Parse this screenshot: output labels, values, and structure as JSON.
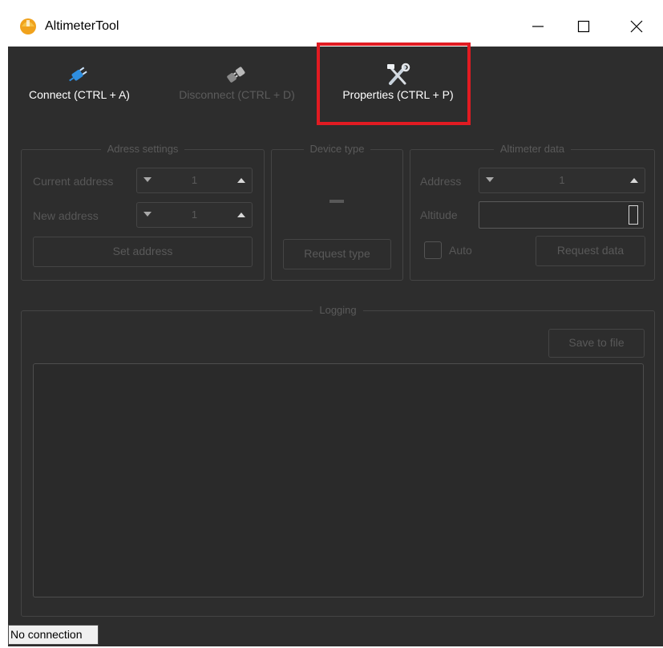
{
  "window": {
    "title": "AltimeterTool",
    "controls": {
      "minimize": "minimize-icon",
      "maximize": "maximize-icon",
      "close": "close-icon"
    }
  },
  "toolbar": {
    "connect_label": "Connect (CTRL + A)",
    "disconnect_label": "Disconnect (CTRL + D)",
    "properties_label": "Properties (CTRL + P)",
    "highlight_color": "#e11b22"
  },
  "address_settings": {
    "title": "Adress settings",
    "current_address_label": "Current address",
    "current_address_value": "1",
    "new_address_label": "New address",
    "new_address_value": "1",
    "set_button": "Set address"
  },
  "device_type": {
    "title": "Device type",
    "value": "-",
    "request_button": "Request type"
  },
  "altimeter_data": {
    "title": "Altimeter data",
    "address_label": "Address",
    "address_value": "1",
    "altitude_label": "Altitude",
    "altitude_value": "",
    "auto_label": "Auto",
    "auto_checked": false,
    "request_button": "Request data"
  },
  "logging": {
    "title": "Logging",
    "save_button": "Save to file",
    "log_text": ""
  },
  "status_bar": {
    "text": "No connection"
  },
  "colors": {
    "background": "#2d2d2d",
    "disabled_text": "#575757",
    "border": "#454545"
  }
}
